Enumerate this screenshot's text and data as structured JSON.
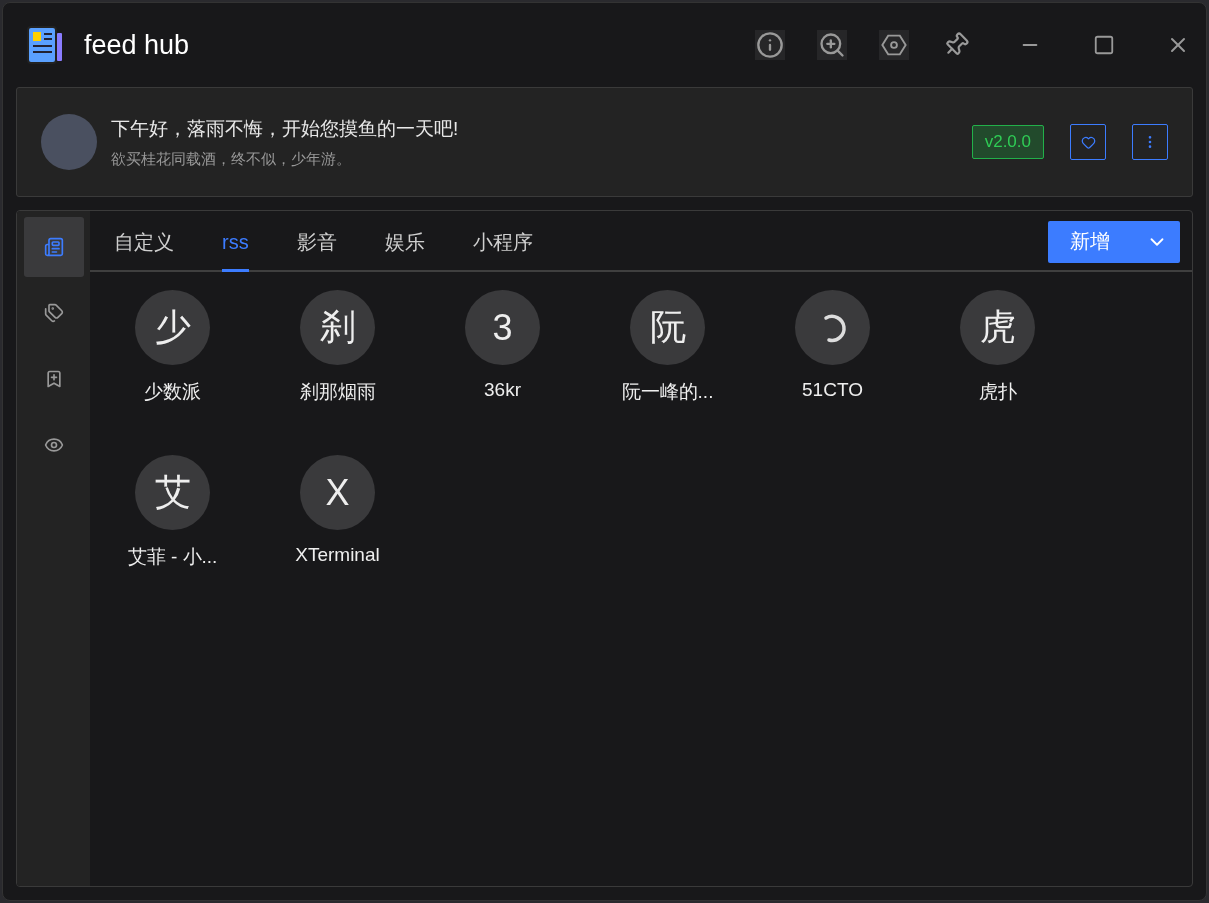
{
  "window": {
    "title": "feed hub"
  },
  "header": {
    "greeting": "下午好，落雨不悔，开始您摸鱼的一天吧!",
    "motto": "欲买桂花同载酒，终不似，少年游。",
    "version": "v2.0.0"
  },
  "sidebar": {
    "items": [
      {
        "selected": true
      },
      {
        "selected": false
      },
      {
        "selected": false
      },
      {
        "selected": false
      }
    ]
  },
  "tabs": [
    {
      "label": "自定义",
      "selected": false
    },
    {
      "label": "rss",
      "selected": true
    },
    {
      "label": "影音",
      "selected": false
    },
    {
      "label": "娱乐",
      "selected": false
    },
    {
      "label": "小程序",
      "selected": false
    }
  ],
  "add_button": {
    "label": "新增"
  },
  "feeds": [
    {
      "kind": "letter",
      "letter": "少",
      "name": "少数派"
    },
    {
      "kind": "letter",
      "letter": "刹",
      "name": "刹那烟雨"
    },
    {
      "kind": "letter",
      "letter": "3",
      "name": "36kr"
    },
    {
      "kind": "letter",
      "letter": "阮",
      "name": "阮一峰的..."
    },
    {
      "kind": "loading",
      "name": "51CTO"
    },
    {
      "kind": "letter",
      "letter": "虎",
      "name": "虎扑"
    },
    {
      "kind": "letter",
      "letter": "艾",
      "name": "艾菲 - 小..."
    },
    {
      "kind": "letter",
      "letter": "X",
      "name": "XTerminal"
    }
  ]
}
